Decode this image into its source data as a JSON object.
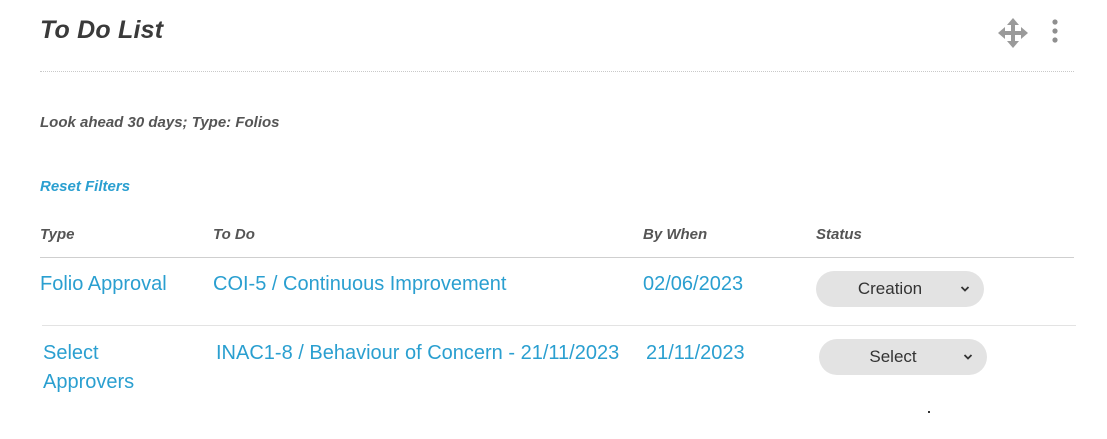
{
  "widget": {
    "title": "To Do List",
    "move_icon": "move-icon",
    "menu_icon": "kebab-menu-icon"
  },
  "filters": {
    "summary": "Look ahead 30 days; Type: Folios",
    "reset_label": "Reset Filters"
  },
  "table": {
    "headers": {
      "type": "Type",
      "todo": "To Do",
      "by_when": "By When",
      "status": "Status"
    },
    "rows": [
      {
        "type_line1": "Folio Approval",
        "type_line2": "",
        "todo": "COI-5 / Continuous Improvement",
        "by_when": "02/06/2023",
        "status": "Creation"
      },
      {
        "type_line1": "Select",
        "type_line2": "Approvers",
        "todo": "INAC1-8 / Behaviour of Concern - 21/11/2023",
        "by_when": "21/11/2023",
        "status": "Select"
      }
    ]
  },
  "colors": {
    "link": "#2a9fd0",
    "title": "#3a3a3a",
    "select_bg": "#e3e3e3"
  }
}
